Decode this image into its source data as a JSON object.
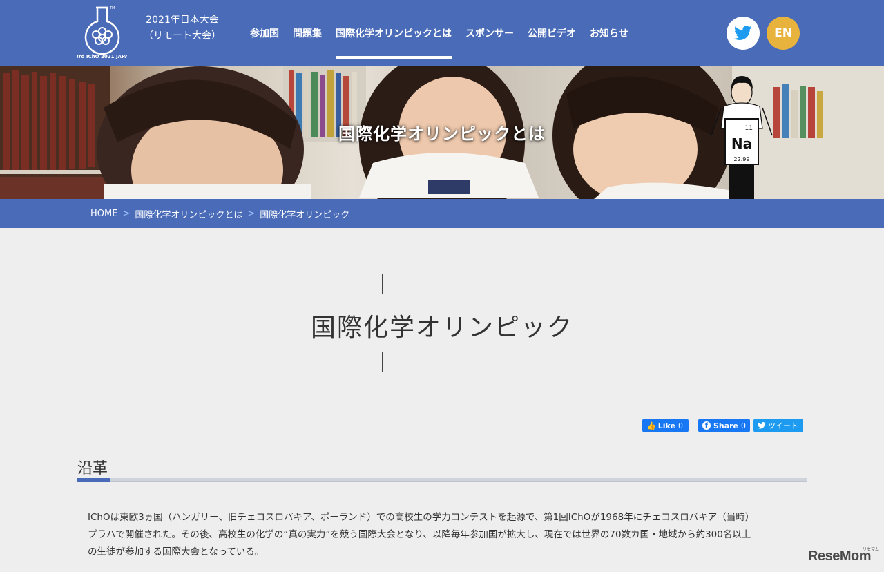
{
  "header": {
    "logo_text": "53rd IChO 2021 JAPAN",
    "event_line1": "2021年日本大会",
    "event_line2": "（リモート大会）",
    "nav": [
      {
        "label": "参加国"
      },
      {
        "label": "問題集"
      },
      {
        "label": "国際化学オリンピックとは",
        "active": true
      },
      {
        "label": "スポンサー"
      },
      {
        "label": "公開ビデオ"
      },
      {
        "label": "お知らせ"
      }
    ],
    "lang_label": "EN",
    "colors": {
      "header_bg": "#4a6cb8",
      "lang_btn": "#e8b33c"
    }
  },
  "hero": {
    "title": "国際化学オリンピックとは",
    "mascot_symbol": "Na",
    "mascot_number": "11",
    "mascot_mass": "22.99"
  },
  "breadcrumb": {
    "items": [
      "HOME",
      "国際化学オリンピックとは",
      "国際化学オリンピック"
    ],
    "separator": ">"
  },
  "page": {
    "title": "国際化学オリンピック"
  },
  "social": {
    "like_label": "Like",
    "like_count": "0",
    "share_label": "Share",
    "share_count": "0",
    "tweet_label": "ツイート"
  },
  "section": {
    "heading": "沿革",
    "body_lines": [
      "IChOは東欧3ヵ国（ハンガリー、旧チェコスロバキア、ポーランド）での高校生の学力コンテストを起源で、第1回IChOが1968年にチェコスロバキア（当時）",
      "プラハで開催された。その後、高校生の化学の“真の実力”を競う国際大会となり、以降毎年参加国が拡大し、現在では世界の70数カ国・地域から約300名以上",
      "の生徒が参加する国際大会となっている。"
    ]
  },
  "watermark": {
    "text": "ReseMom",
    "small": "リセマム"
  }
}
